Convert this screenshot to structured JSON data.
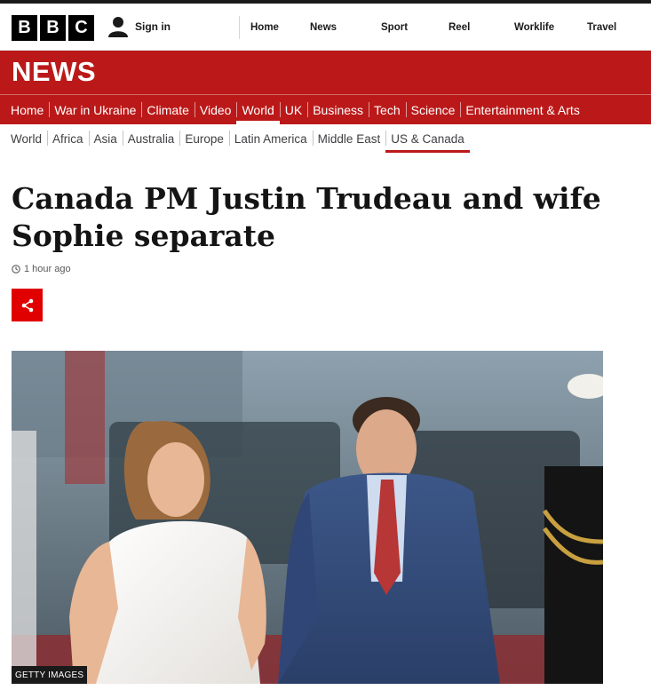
{
  "masthead": {
    "logo_letters": [
      "B",
      "B",
      "C"
    ],
    "signin_label": "Sign in",
    "nav": [
      "Home",
      "News",
      "Sport",
      "Reel",
      "Worklife",
      "Travel"
    ]
  },
  "brand": {
    "title": "NEWS",
    "color": "#bb1919"
  },
  "section_nav": {
    "items": [
      "Home",
      "War in Ukraine",
      "Climate",
      "Video",
      "World",
      "UK",
      "Business",
      "Tech",
      "Science",
      "Entertainment & Arts"
    ],
    "active": "World"
  },
  "sub_nav": {
    "items": [
      "World",
      "Africa",
      "Asia",
      "Australia",
      "Europe",
      "Latin America",
      "Middle East",
      "US & Canada"
    ],
    "active": "US & Canada"
  },
  "article": {
    "headline": "Canada PM Justin Trudeau and wife Sophie separate",
    "timestamp": "1 hour ago",
    "share_icon": "share-icon",
    "image_credit": "GETTY IMAGES"
  }
}
